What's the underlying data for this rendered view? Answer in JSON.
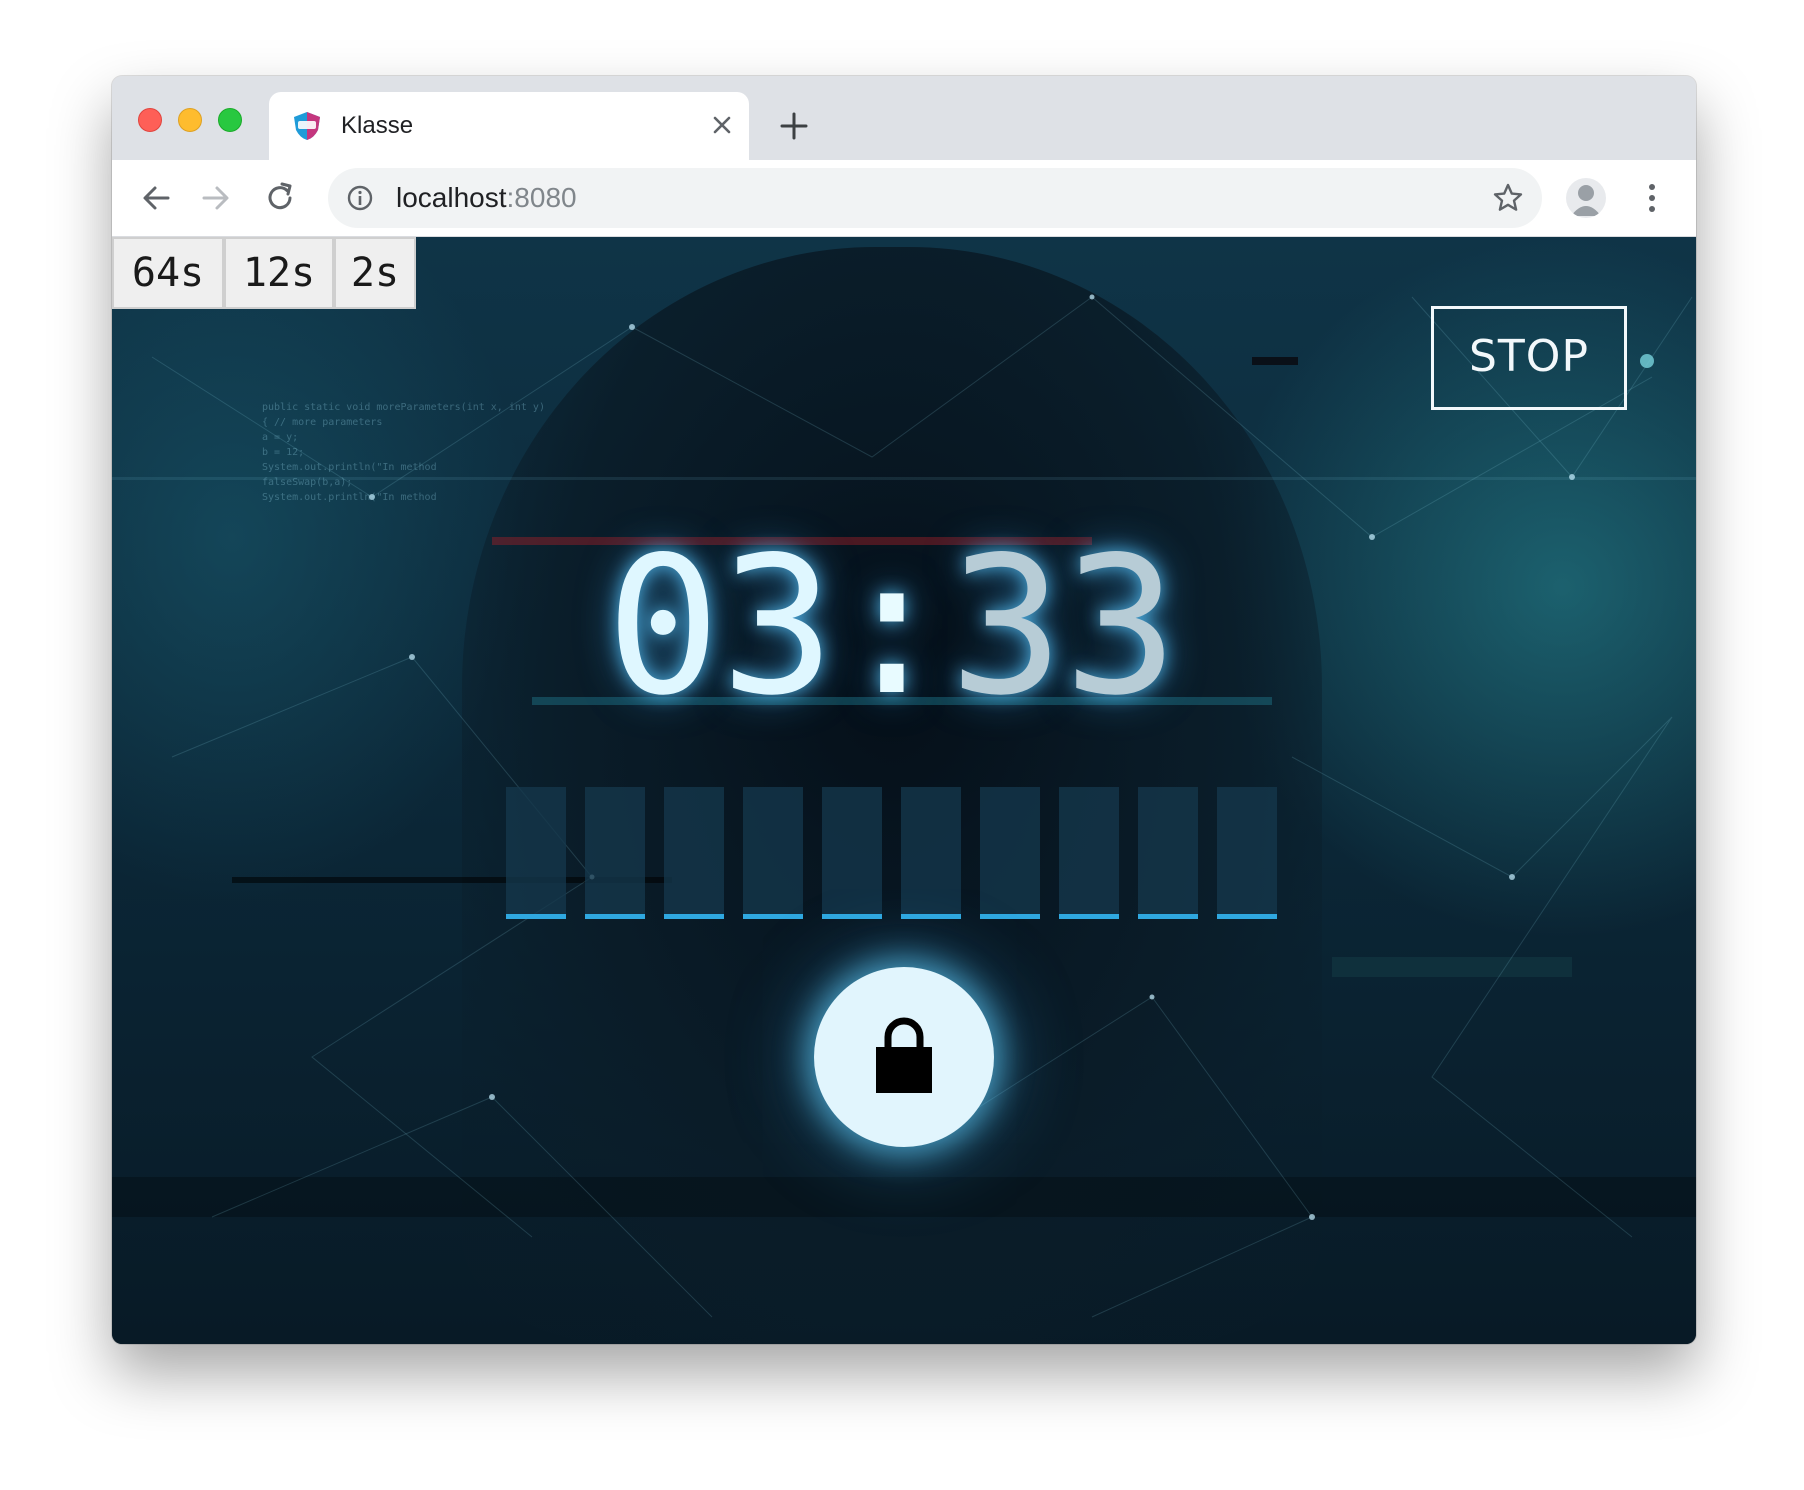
{
  "browser": {
    "tab": {
      "title": "Klasse",
      "favicon": "klasse-shield-logo",
      "close_icon": "close-icon"
    },
    "new_tab_icon": "plus-icon",
    "toolbar": {
      "back_icon": "arrow-left-icon",
      "forward_icon": "arrow-right-icon",
      "reload_icon": "reload-icon",
      "url_host": "localhost",
      "url_port": ":8080",
      "info_icon": "info-icon",
      "bookmark_icon": "star-icon",
      "profile_icon": "avatar-icon",
      "menu_icon": "kebab-menu-icon"
    }
  },
  "app": {
    "timers": [
      "64s",
      "12s",
      "2s"
    ],
    "stop_label": "STOP",
    "clock": {
      "minutes": "03",
      "separator": ":",
      "seconds": "33"
    },
    "code_slots": [
      "",
      "",
      "",
      "",
      "",
      "",
      "",
      "",
      "",
      ""
    ],
    "lock_icon": "lock-icon",
    "colors": {
      "glow": "#5ac8ff",
      "slot_underline": "#2fa8e0",
      "lock_button_bg": "#e1f5fd",
      "clock_minutes": "#dff7ff",
      "clock_seconds": "#b7ccd6"
    }
  }
}
